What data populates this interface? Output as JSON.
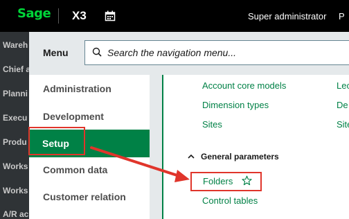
{
  "topbar": {
    "logo": "Sage",
    "product": "X3",
    "user": "Super administrator",
    "user_partial": "P"
  },
  "background_items": [
    "Wareh",
    "Chief a",
    "Planni",
    "Execu",
    "Produ",
    "Works",
    "Works",
    "A/R ac"
  ],
  "menu": {
    "title": "Menu",
    "search_placeholder": "Search the navigation menu..."
  },
  "left_nav": [
    {
      "label": "Administration",
      "active": false
    },
    {
      "label": "Development",
      "active": false
    },
    {
      "label": "Setup",
      "active": true
    },
    {
      "label": "Common data",
      "active": false
    },
    {
      "label": "Customer relation",
      "active": false
    }
  ],
  "content": {
    "col1_links": [
      "Account core models",
      "Dimension types",
      "Sites"
    ],
    "col2_partial": [
      "Lec",
      "De",
      "Site"
    ],
    "section_title": "General parameters",
    "section_links": [
      "Folders",
      "Control tables"
    ]
  },
  "colors": {
    "brand_green": "#008146",
    "logo_green": "#00d639",
    "annotation_red": "#e0352b",
    "topbar_bg": "#000000"
  }
}
